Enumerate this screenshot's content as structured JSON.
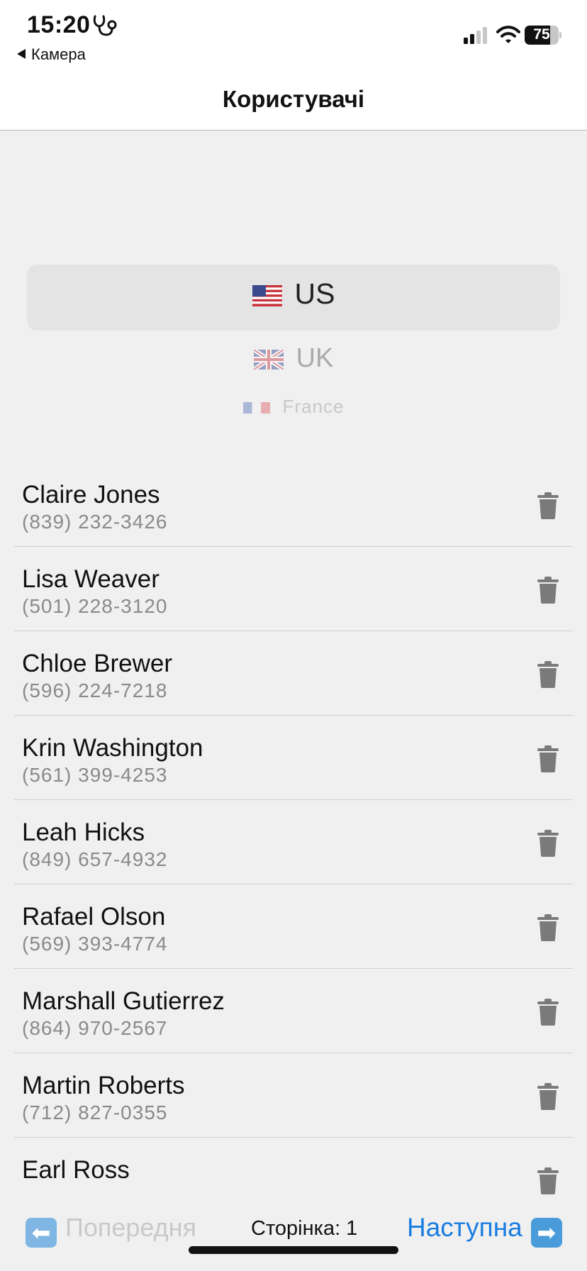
{
  "status_bar": {
    "time": "15:20",
    "back_app": "Камера",
    "battery_percent": "75",
    "battery_level": 0.75
  },
  "nav": {
    "title": "Користувачі"
  },
  "picker": {
    "selected": {
      "flag": "us-flag-icon",
      "label": "US"
    },
    "options": [
      {
        "flag": "us-flag-icon",
        "label": "US"
      },
      {
        "flag": "uk-flag-icon",
        "label": "UK"
      },
      {
        "flag": "fr-flag-icon",
        "label": "France"
      }
    ]
  },
  "users": [
    {
      "name": "Claire Jones",
      "phone": "(839) 232-3426"
    },
    {
      "name": "Lisa Weaver",
      "phone": "(501) 228-3120"
    },
    {
      "name": "Chloe Brewer",
      "phone": "(596) 224-7218"
    },
    {
      "name": "Krin Washington",
      "phone": "(561) 399-4253"
    },
    {
      "name": "Leah Hicks",
      "phone": "(849) 657-4932"
    },
    {
      "name": "Rafael Olson",
      "phone": "(569) 393-4774"
    },
    {
      "name": "Marshall Gutierrez",
      "phone": "(864) 970-2567"
    },
    {
      "name": "Martin Roberts",
      "phone": "(712) 827-0355"
    },
    {
      "name": "Earl Ross",
      "phone": ""
    }
  ],
  "pagination": {
    "prev_label": "Попередня",
    "page_label": "Сторінка: 1",
    "next_label": "Наступна",
    "prev_icon": "⬅",
    "next_icon": "➡"
  },
  "colors": {
    "accent": "#1a7de0",
    "disabled": "#c9c9c9",
    "trash": "#7a7a7a"
  }
}
